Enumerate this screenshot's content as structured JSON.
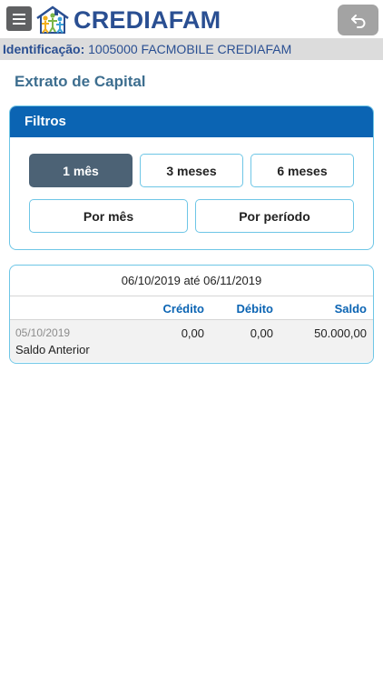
{
  "header": {
    "menu_icon": "hamburger-menu-icon",
    "brand": "CREDIAFAM",
    "logo_icon": "family-house-logo",
    "back_icon": "undo-arrow-icon",
    "colors": {
      "brand": "#2a4f92",
      "menu_bg": "#5f6062",
      "back_bg": "#a3a3a3"
    }
  },
  "identification": {
    "label": "Identificação:",
    "value": "1005000 FACMOBILE CREDIAFAM"
  },
  "page": {
    "title": "Extrato de Capital"
  },
  "filters": {
    "title": "Filtros",
    "buttons": [
      {
        "label": "1 mês",
        "active": true
      },
      {
        "label": "3 meses",
        "active": false
      },
      {
        "label": "6 meses",
        "active": false
      },
      {
        "label": "Por mês",
        "active": false
      },
      {
        "label": "Por período",
        "active": false
      }
    ],
    "colors": {
      "header_bg": "#0b64b3",
      "active_bg": "#4c6275",
      "border": "#6ec6e6"
    }
  },
  "statement": {
    "period": "06/10/2019 até 06/11/2019",
    "columns": [
      "Crédito",
      "Débito",
      "Saldo"
    ],
    "rows": [
      {
        "date": "05/10/2019",
        "description": "Saldo Anterior",
        "credito": "0,00",
        "debito": "0,00",
        "saldo": "50.000,00"
      }
    ]
  }
}
